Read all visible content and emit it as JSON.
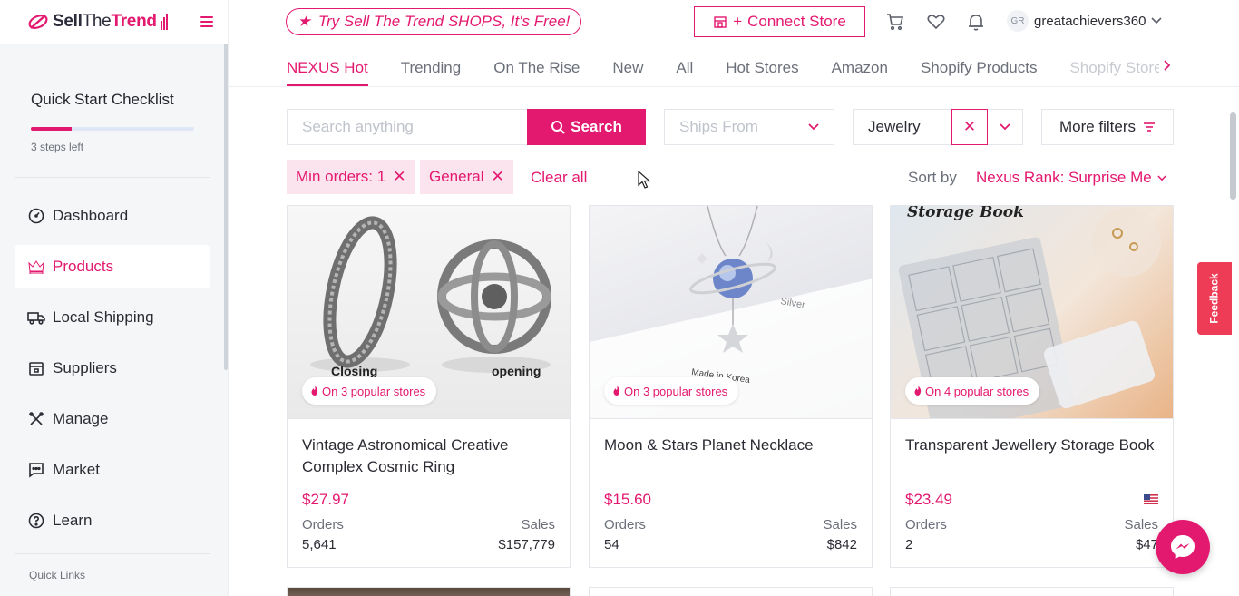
{
  "brand": {
    "name_part1": "Sell",
    "name_part2": "The",
    "name_part3": "Trend",
    "accent": "#e3186f"
  },
  "sidebar": {
    "checklist_title": "Quick Start Checklist",
    "checklist_progress": 0.25,
    "steps_left": "3 steps left",
    "items": [
      {
        "label": "Dashboard",
        "icon": "gauge-icon",
        "active": false
      },
      {
        "label": "Products",
        "icon": "crown-icon",
        "active": true
      },
      {
        "label": "Local Shipping",
        "icon": "truck-icon",
        "active": false
      },
      {
        "label": "Suppliers",
        "icon": "store-icon",
        "active": false
      },
      {
        "label": "Manage",
        "icon": "tools-icon",
        "active": false
      },
      {
        "label": "Market",
        "icon": "chat-icon",
        "active": false
      },
      {
        "label": "Learn",
        "icon": "help-icon",
        "active": false
      }
    ],
    "quick_links": "Quick Links"
  },
  "header": {
    "shops_promo": "Try Sell The Trend SHOPS, It's Free!",
    "connect_store": "Connect Store",
    "username": "greatachievers360",
    "avatar_initials": "GR"
  },
  "tabs": [
    "NEXUS Hot",
    "Trending",
    "On The Rise",
    "New",
    "All",
    "Hot Stores",
    "Amazon",
    "Shopify Products",
    "Shopify Stores"
  ],
  "filters": {
    "search_placeholder": "Search anything",
    "search_button": "Search",
    "ships_from_placeholder": "Ships From",
    "category_value": "Jewelry",
    "more_filters": "More filters",
    "chips": [
      "Min orders: 1",
      "General"
    ],
    "clear_all": "Clear all",
    "sort_label": "Sort by",
    "sort_value": "Nexus Rank: Surprise Me"
  },
  "products": [
    {
      "name": "Vintage Astronomical Creative Complex Cosmic Ring",
      "price": "$27.97",
      "badge": "On 3 popular stores",
      "orders_label": "Orders",
      "orders": "5,641",
      "sales_label": "Sales",
      "sales": "$157,779",
      "caption_left": "Closing",
      "caption_right": "opening",
      "flag": false
    },
    {
      "name": "Moon & Stars Planet Necklace",
      "price": "$15.60",
      "badge": "On 3 popular stores",
      "orders_label": "Orders",
      "orders": "54",
      "sales_label": "Sales",
      "sales": "$842",
      "img_text1": "Silver",
      "img_text2": "Made in Korea",
      "flag": false
    },
    {
      "name": "Transparent Jewellery Storage Book",
      "price": "$23.49",
      "badge": "On 4 popular stores",
      "orders_label": "Orders",
      "orders": "2",
      "sales_label": "Sales",
      "sales": "$47",
      "img_text1": "Storage Book",
      "flag": true
    }
  ],
  "feedback": "Feedback"
}
